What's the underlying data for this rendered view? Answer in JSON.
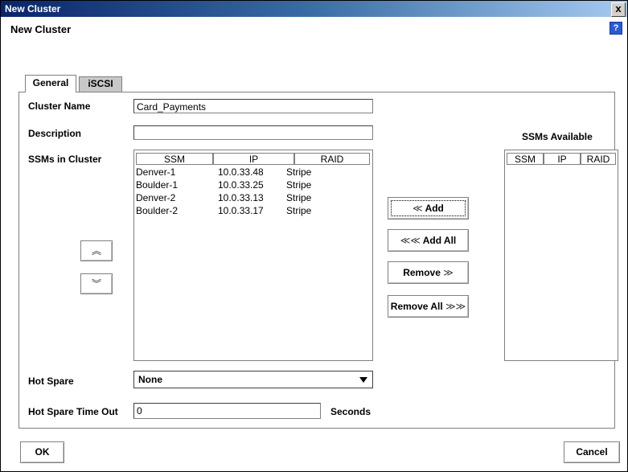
{
  "window": {
    "title": "New Cluster",
    "close_label": "x"
  },
  "header": {
    "title": "New Cluster",
    "help_label": "?"
  },
  "tabs": [
    {
      "label": "General"
    },
    {
      "label": "iSCSI"
    }
  ],
  "form": {
    "cluster_name_label": "Cluster Name",
    "cluster_name_value": "Card_Payments",
    "description_label": "Description",
    "description_value": "",
    "ssms_in_cluster_label": "SSMs in Cluster",
    "ssms_available_label": "SSMs Available",
    "hot_spare_label": "Hot Spare",
    "hot_spare_value": "None",
    "hot_spare_timeout_label": "Hot Spare Time Out",
    "hot_spare_timeout_value": "0",
    "seconds_label": "Seconds"
  },
  "cluster_table": {
    "columns": [
      "SSM",
      "IP",
      "RAID"
    ],
    "rows": [
      {
        "ssm": "Denver-1",
        "ip": "10.0.33.48",
        "raid": "Stripe"
      },
      {
        "ssm": "Boulder-1",
        "ip": "10.0.33.25",
        "raid": "Stripe"
      },
      {
        "ssm": "Denver-2",
        "ip": "10.0.33.13",
        "raid": "Stripe"
      },
      {
        "ssm": "Boulder-2",
        "ip": "10.0.33.17",
        "raid": "Stripe"
      }
    ]
  },
  "available_table": {
    "columns": [
      "SSM",
      "IP",
      "RAID"
    ],
    "rows": []
  },
  "buttons": {
    "add": "Add",
    "add_all": "Add All",
    "remove": "Remove",
    "remove_all": "Remove All",
    "move_up": "︽",
    "move_down": "︾",
    "ok": "OK",
    "cancel": "Cancel"
  },
  "glyphs": {
    "left_single": "≪",
    "left_double": "≪≪",
    "right_single": "≫",
    "right_double": "≫≫"
  }
}
